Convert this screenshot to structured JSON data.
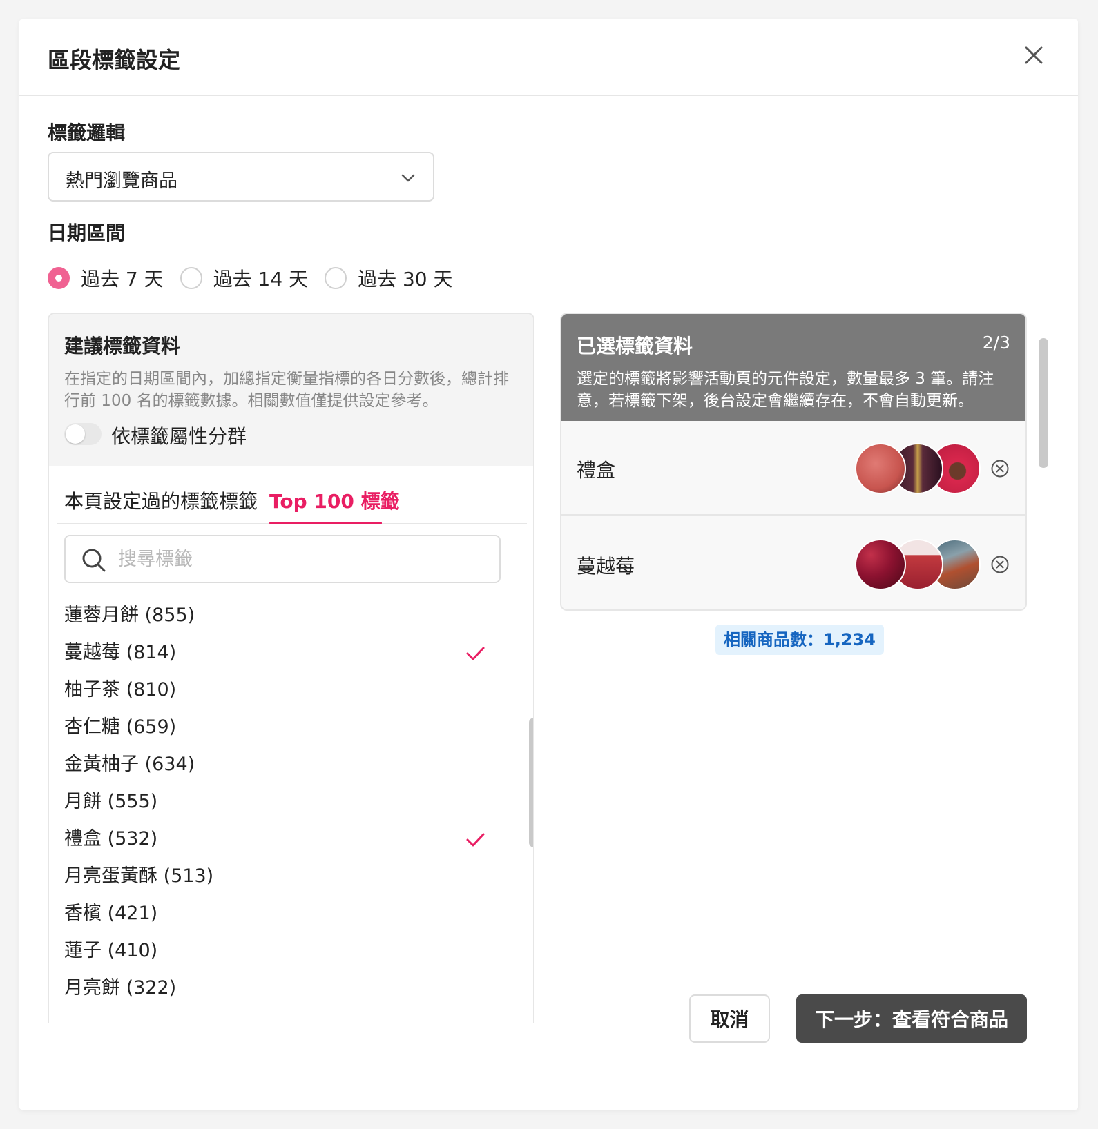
{
  "modal": {
    "title": "區段標籤設定"
  },
  "logic": {
    "label": "標籤邏輯",
    "selected": "熱門瀏覽商品"
  },
  "date_range": {
    "label": "日期區間",
    "options": [
      {
        "label": "過去 7 天",
        "checked": true
      },
      {
        "label": "過去 14 天",
        "checked": false
      },
      {
        "label": "過去 30 天",
        "checked": false
      }
    ]
  },
  "suggested": {
    "title": "建議標籤資料",
    "description": "在指定的日期區間內，加總指定衡量指標的各日分數後，總計排行前 100 名的標籤數據。相關數值僅提供設定參考。",
    "toggle_label": "依標籤屬性分群",
    "toggle_on": false,
    "tabs": [
      {
        "label": "本頁設定過的標籤標籤",
        "active": false
      },
      {
        "label": "Top 100 標籤",
        "active": true
      }
    ],
    "search_placeholder": "搜尋標籤",
    "items": [
      {
        "label": "蓮蓉月餅 (855)",
        "checked": false
      },
      {
        "label": "蔓越莓 (814)",
        "checked": true
      },
      {
        "label": "柚子茶 (810)",
        "checked": false
      },
      {
        "label": "杏仁糖 (659)",
        "checked": false
      },
      {
        "label": "金黃柚子 (634)",
        "checked": false
      },
      {
        "label": "月餅 (555)",
        "checked": false
      },
      {
        "label": "禮盒 (532)",
        "checked": true
      },
      {
        "label": "月亮蛋黃酥 (513)",
        "checked": false
      },
      {
        "label": "香檳 (421)",
        "checked": false
      },
      {
        "label": "蓮子 (410)",
        "checked": false
      },
      {
        "label": "月亮餅 (322)",
        "checked": false
      }
    ]
  },
  "selected_panel": {
    "title": "已選標籤資料",
    "count": "2/3",
    "description": "選定的標籤將影響活動頁的元件設定，數量最多 3 筆。請注意，若標籤下架，後台設定會繼續存在，不會自動更新。",
    "rows": [
      {
        "name": "禮盒",
        "thumb_colors": [
          "#c8554f",
          "#5a2a3a",
          "#d9274d"
        ]
      },
      {
        "name": "蔓越莓",
        "thumb_colors": [
          "#8c1230",
          "#c23a3f",
          "#6b4a3a"
        ]
      }
    ]
  },
  "related_count": "相關商品數：1,234",
  "footer": {
    "cancel_label": "取消",
    "next_label": "下一步：查看符合商品"
  },
  "colors": {
    "accent": "#e91e63",
    "radio": "#f06292",
    "badge_bg": "#e3f2fd",
    "badge_text": "#1565c0",
    "primary_button": "#4a4a4a"
  }
}
